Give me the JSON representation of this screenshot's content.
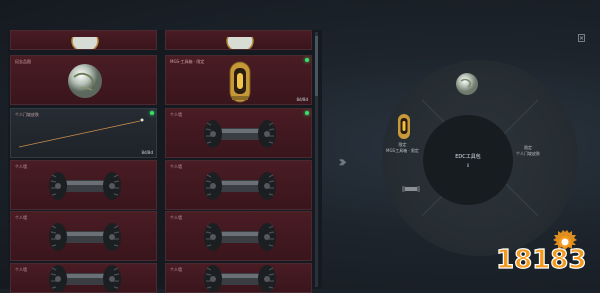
{
  "inventory": {
    "cards": [
      {
        "label": "",
        "count": "",
        "item": "top-orb"
      },
      {
        "label": "",
        "count": "",
        "item": "top-orb"
      },
      {
        "label": "纪念品图",
        "count": "",
        "item": "orb"
      },
      {
        "label": "MGS-工具箱 · 限定",
        "count": "8d/8d",
        "item": "capsule"
      },
      {
        "label": "个人门坡皮肤",
        "count": "8d/8d",
        "item": "beam"
      },
      {
        "label": "个人墙",
        "count": "",
        "item": "roller"
      },
      {
        "label": "个人墙",
        "count": "",
        "item": "roller"
      },
      {
        "label": "个人墙",
        "count": "",
        "item": "roller"
      },
      {
        "label": "个人墙",
        "count": "",
        "item": "roller"
      },
      {
        "label": "个人墙",
        "count": "",
        "item": "roller"
      },
      {
        "label": "个人墙",
        "count": "",
        "item": "roller"
      },
      {
        "label": "个人墙",
        "count": "",
        "item": "roller"
      }
    ]
  },
  "wheel": {
    "title": "EDC工具包",
    "subtitle": "8",
    "left_slot": {
      "top": "限定",
      "label": "MGS工具箱 · 限定"
    },
    "right_slot": {
      "top": "限定",
      "label": "个人门坡皮肤"
    }
  },
  "watermark": {
    "text": "18183"
  },
  "colors": {
    "card_red": "#4a1c24",
    "equipped_green": "#36e06a",
    "watermark_orange": "#f39a1e"
  }
}
